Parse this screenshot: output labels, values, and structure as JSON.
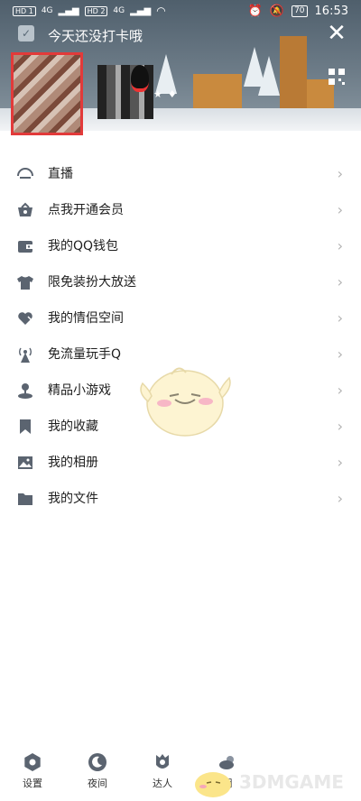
{
  "status_bar": {
    "sim1": "HD 1",
    "sim2": "HD 2",
    "signal1": "4G",
    "signal2": "4G",
    "battery": "70",
    "time": "16:53"
  },
  "header": {
    "checkin_text": "今天还没打卡哦"
  },
  "menu": {
    "items": [
      {
        "label": "直播",
        "icon": "live-icon"
      },
      {
        "label": "点我开通会员",
        "icon": "vip-basket-icon"
      },
      {
        "label": "我的QQ钱包",
        "icon": "wallet-icon"
      },
      {
        "label": "限免装扮大放送",
        "icon": "shirt-icon"
      },
      {
        "label": "我的情侣空间",
        "icon": "hearts-icon"
      },
      {
        "label": "免流量玩手Q",
        "icon": "antenna-icon"
      },
      {
        "label": "精品小游戏",
        "icon": "game-joystick-icon"
      },
      {
        "label": "我的收藏",
        "icon": "bookmark-icon"
      },
      {
        "label": "我的相册",
        "icon": "photo-icon"
      },
      {
        "label": "我的文件",
        "icon": "folder-icon"
      }
    ]
  },
  "bottom_bar": {
    "settings_label": "设置",
    "night_label": "夜间",
    "expert_label": "达人",
    "weather_label": "阴"
  },
  "watermark": {
    "text": "3DMGAME"
  },
  "colors": {
    "icon_gray": "#5b6470",
    "avatar_border": "#e23a3a",
    "chevron": "#b2b2b2"
  }
}
